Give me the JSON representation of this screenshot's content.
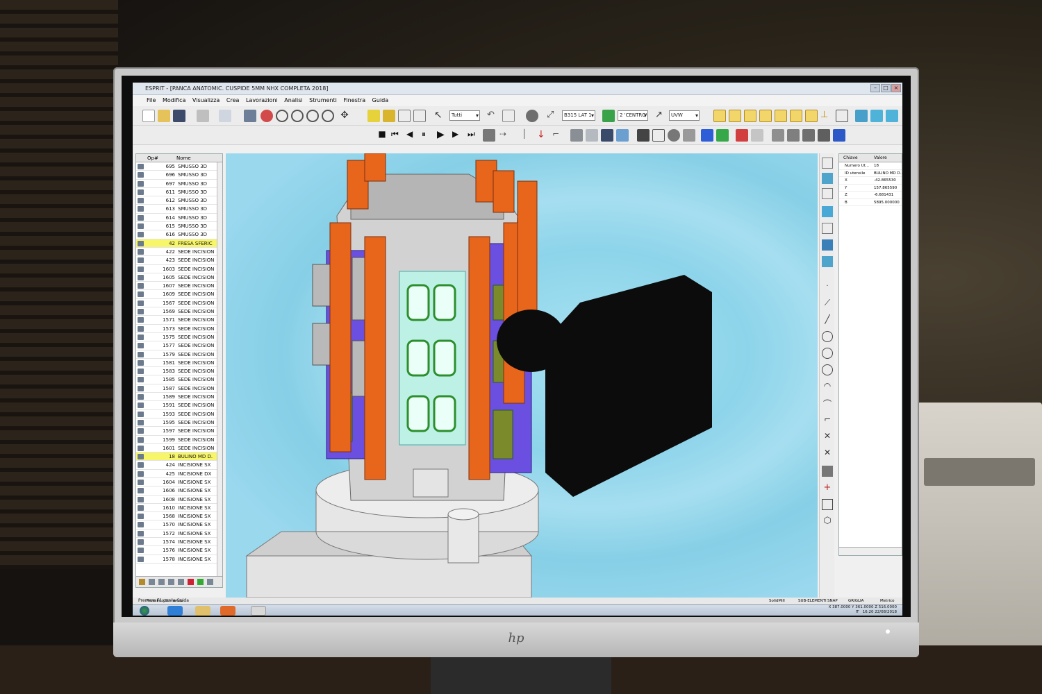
{
  "window": {
    "title": "ESPRIT - [PANCA ANATOMIC. CUSPIDE 5MM NHX COMPLETA 2018]"
  },
  "menu": [
    "File",
    "Modifica",
    "Visualizza",
    "Crea",
    "Lavorazioni",
    "Analisi",
    "Strumenti",
    "Finestra",
    "Guida"
  ],
  "toolbar": {
    "filter_combo": "Tutti",
    "workplane_combo": "B315 LAT 1",
    "layer_combo": "2 'CENTRO'",
    "csys_combo": "UVW"
  },
  "operations_panel": {
    "col_op": "Op#",
    "col_name": "Nome",
    "rows": [
      {
        "num": "695",
        "name": "SMUSSO 3D",
        "hl": false
      },
      {
        "num": "696",
        "name": "SMUSSO 3D",
        "hl": false
      },
      {
        "num": "697",
        "name": "SMUSSO 3D",
        "hl": false
      },
      {
        "num": "611",
        "name": "SMUSSO 3D",
        "hl": false
      },
      {
        "num": "612",
        "name": "SMUSSO 3D",
        "hl": false
      },
      {
        "num": "613",
        "name": "SMUSSO 3D",
        "hl": false
      },
      {
        "num": "614",
        "name": "SMUSSO 3D",
        "hl": false
      },
      {
        "num": "615",
        "name": "SMUSSO 3D",
        "hl": false
      },
      {
        "num": "616",
        "name": "SMUSSO 3D",
        "hl": false
      },
      {
        "num": "42",
        "name": "FRESA SFERIC",
        "hl": true
      },
      {
        "num": "422",
        "name": "SEDE INCISION",
        "hl": false
      },
      {
        "num": "423",
        "name": "SEDE INCISION",
        "hl": false
      },
      {
        "num": "1603",
        "name": "SEDE INCISION",
        "hl": false
      },
      {
        "num": "1605",
        "name": "SEDE INCISION",
        "hl": false
      },
      {
        "num": "1607",
        "name": "SEDE INCISION",
        "hl": false
      },
      {
        "num": "1609",
        "name": "SEDE INCISION",
        "hl": false
      },
      {
        "num": "1567",
        "name": "SEDE INCISION",
        "hl": false
      },
      {
        "num": "1569",
        "name": "SEDE INCISION",
        "hl": false
      },
      {
        "num": "1571",
        "name": "SEDE INCISION",
        "hl": false
      },
      {
        "num": "1573",
        "name": "SEDE INCISION",
        "hl": false
      },
      {
        "num": "1575",
        "name": "SEDE INCISION",
        "hl": false
      },
      {
        "num": "1577",
        "name": "SEDE INCISION",
        "hl": false
      },
      {
        "num": "1579",
        "name": "SEDE INCISION",
        "hl": false
      },
      {
        "num": "1581",
        "name": "SEDE INCISION",
        "hl": false
      },
      {
        "num": "1583",
        "name": "SEDE INCISION",
        "hl": false
      },
      {
        "num": "1585",
        "name": "SEDE INCISION",
        "hl": false
      },
      {
        "num": "1587",
        "name": "SEDE INCISION",
        "hl": false
      },
      {
        "num": "1589",
        "name": "SEDE INCISION",
        "hl": false
      },
      {
        "num": "1591",
        "name": "SEDE INCISION",
        "hl": false
      },
      {
        "num": "1593",
        "name": "SEDE INCISION",
        "hl": false
      },
      {
        "num": "1595",
        "name": "SEDE INCISION",
        "hl": false
      },
      {
        "num": "1597",
        "name": "SEDE INCISION",
        "hl": false
      },
      {
        "num": "1599",
        "name": "SEDE INCISION",
        "hl": false
      },
      {
        "num": "1601",
        "name": "SEDE INCISION",
        "hl": false
      },
      {
        "num": "18",
        "name": "BULINO MD D.",
        "hl": true
      },
      {
        "num": "424",
        "name": "INCISIONE SX",
        "hl": false
      },
      {
        "num": "425",
        "name": "INCISIONE DX",
        "hl": false
      },
      {
        "num": "1604",
        "name": "INCISIONE SX",
        "hl": false
      },
      {
        "num": "1606",
        "name": "INCISIONE SX",
        "hl": false
      },
      {
        "num": "1608",
        "name": "INCISIONE SX",
        "hl": false
      },
      {
        "num": "1610",
        "name": "INCISIONE SX",
        "hl": false
      },
      {
        "num": "1568",
        "name": "INCISIONE SX",
        "hl": false
      },
      {
        "num": "1570",
        "name": "INCISIONE SX",
        "hl": false
      },
      {
        "num": "1572",
        "name": "INCISIONE SX",
        "hl": false
      },
      {
        "num": "1574",
        "name": "INCISIONE SX",
        "hl": false
      },
      {
        "num": "1576",
        "name": "INCISIONE SX",
        "hl": false
      },
      {
        "num": "1578",
        "name": "INCISIONE SX",
        "hl": false
      }
    ]
  },
  "properties_panel": {
    "col_key": "Chiave",
    "col_value": "Valore",
    "rows": [
      {
        "key": "Numero Ut...",
        "value": "18"
      },
      {
        "key": "ID utensile",
        "value": "BULINO MD D..."
      },
      {
        "key": "X",
        "value": "-42.865530"
      },
      {
        "key": "Y",
        "value": "157.865590"
      },
      {
        "key": "Z",
        "value": "-6.681431"
      },
      {
        "key": "B",
        "value": "5895.000000"
      }
    ]
  },
  "status": {
    "solidmill": "SolidMill",
    "sub_elements": "SUB-ELEMENTI",
    "snap": "SNAP",
    "griglia": "GRIGLIA",
    "metrico": "Metrico",
    "x": "X 387.0000",
    "y": "Y 361.0000",
    "z": "Z 516.0000"
  },
  "command": {
    "line1": "Prossimo Comando",
    "line2": "Premere F1 per la Guida"
  },
  "tray": {
    "lang": "IT",
    "time": "16:20",
    "date": "22/08/2018"
  },
  "colors": {
    "orange": "#e8651c",
    "purple": "#6a4fe0",
    "green": "#49c43a",
    "viewport": "#9ad8ee",
    "highlight": "#f7f56a"
  }
}
